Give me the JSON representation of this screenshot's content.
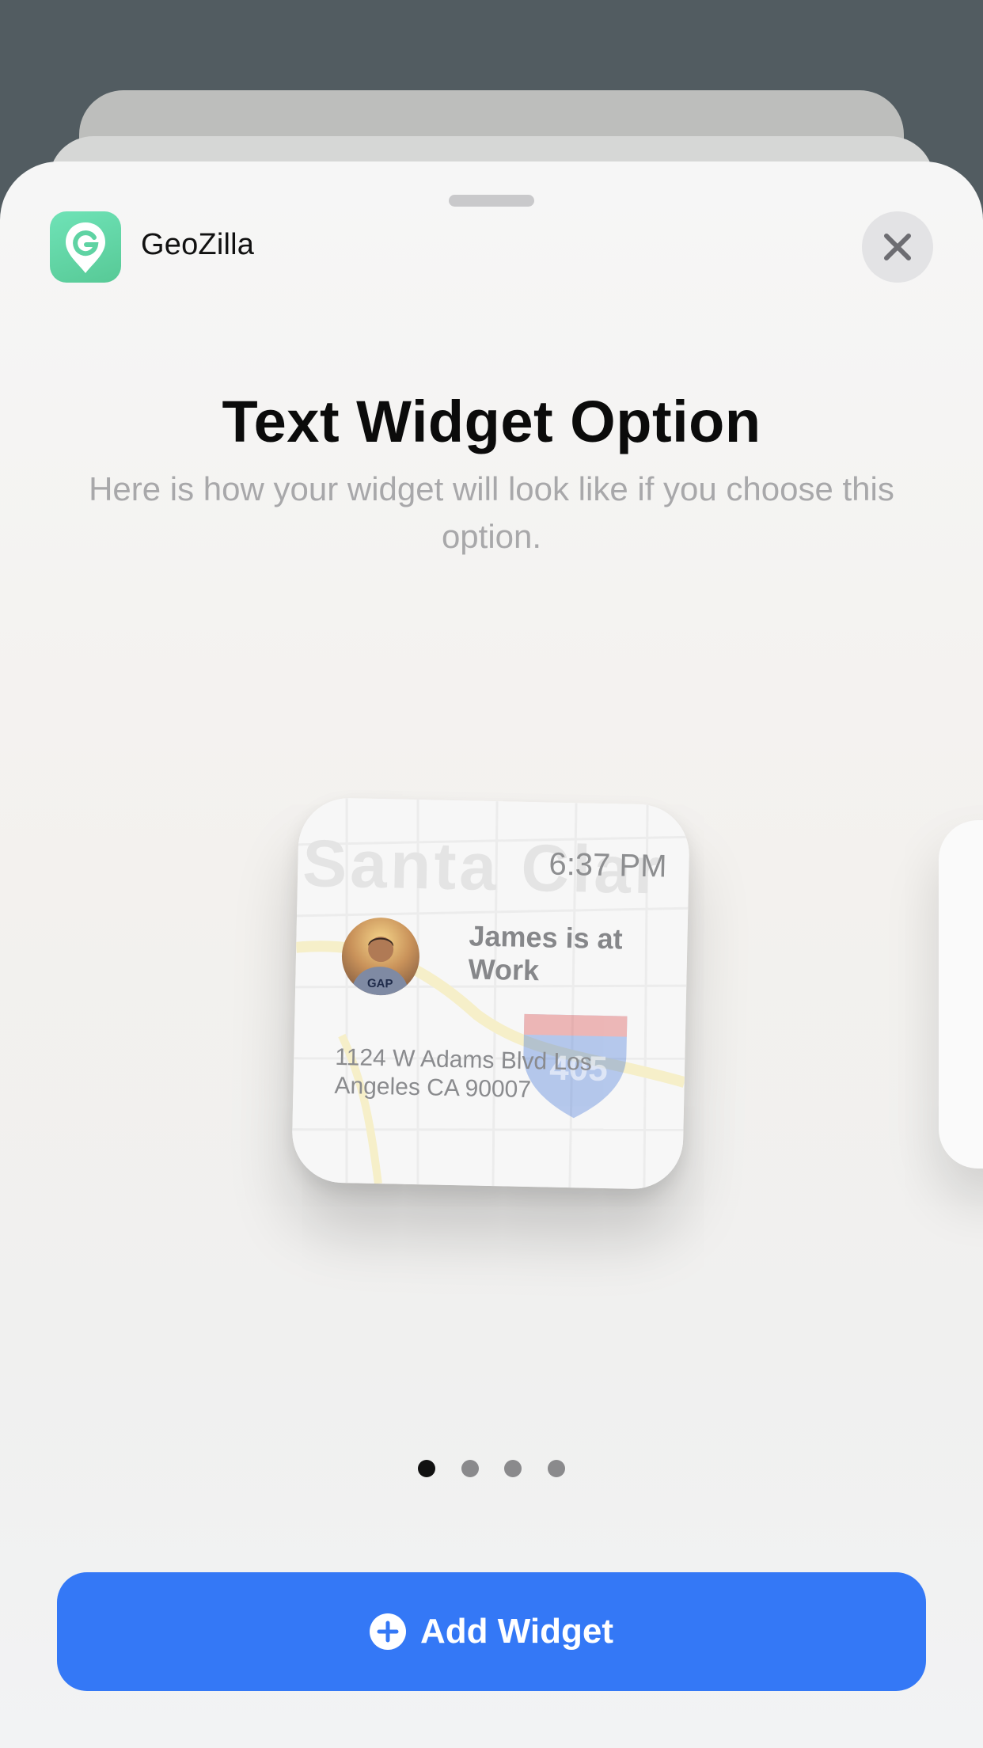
{
  "app": {
    "name": "GeoZilla",
    "icon": "geozilla-pin-icon"
  },
  "close": {
    "icon": "close-icon"
  },
  "header": {
    "title": "Text Widget Option",
    "subtitle": "Here is how your widget will look like if you choose this option."
  },
  "widget": {
    "time": "6:37 PM",
    "status": "James is at Work",
    "address": "1124 W Adams Blvd Los Angeles CA 90007",
    "map_labels": {
      "city": "Santa Clar",
      "highway": "405"
    }
  },
  "pagination": {
    "total": 4,
    "active": 1
  },
  "add_button": {
    "label": "Add Widget",
    "icon": "plus-circle-icon"
  },
  "colors": {
    "accent": "#3478f6",
    "app_icon": "#5fd3a3"
  }
}
